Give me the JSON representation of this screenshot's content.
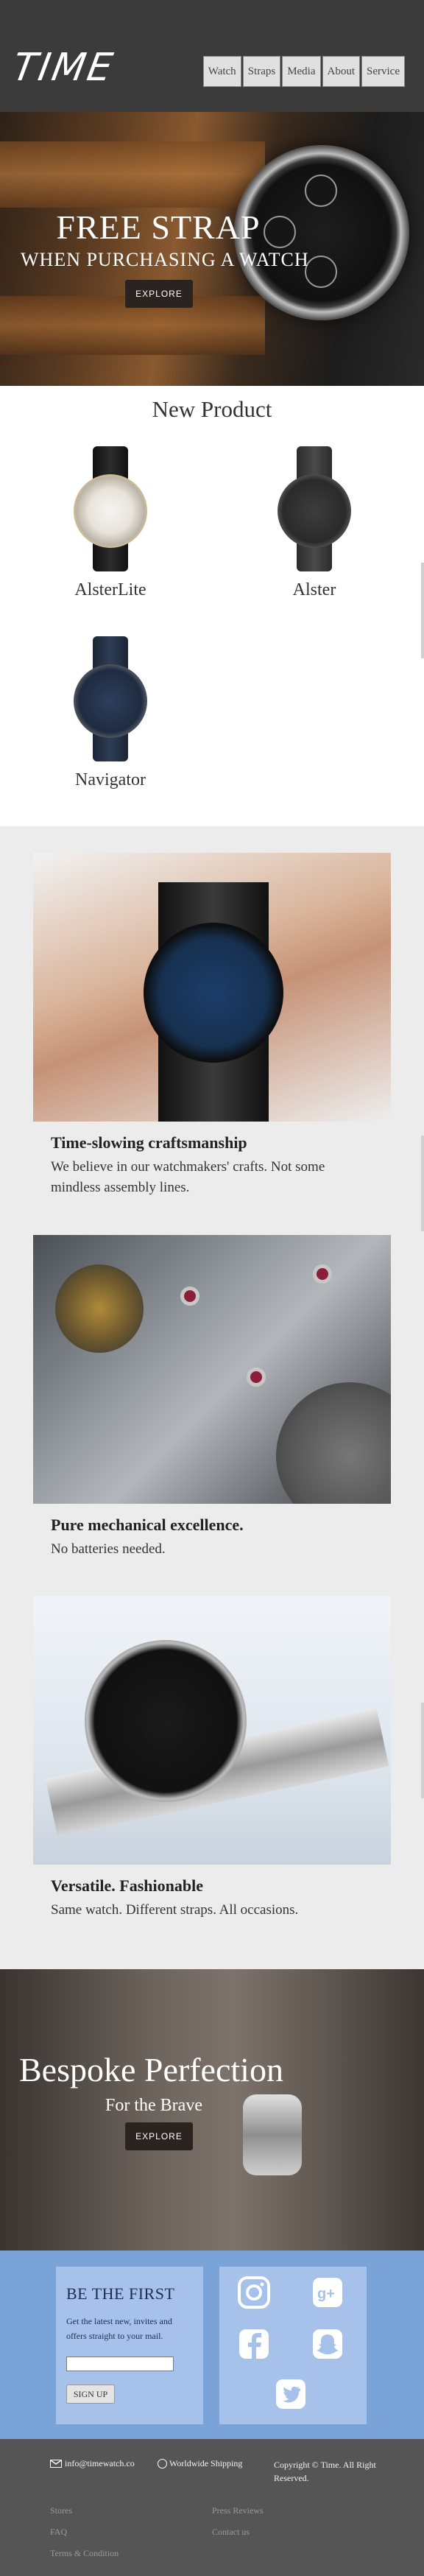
{
  "header": {
    "logo": "TIME",
    "nav": [
      "Watch",
      "Straps",
      "Media",
      "About",
      "Service"
    ]
  },
  "hero": {
    "title": "FREE STRAP",
    "subtitle": "WHEN PURCHASING A WATCH",
    "button": "EXPLORE"
  },
  "new_product": {
    "title": "New Product",
    "items": [
      {
        "name": "AlsterLite"
      },
      {
        "name": "Alster"
      },
      {
        "name": "Navigator"
      }
    ]
  },
  "features": [
    {
      "heading": "Time-slowing craftsmanship",
      "text": "We believe in our watchmakers' crafts. Not some mindless assembly lines."
    },
    {
      "heading": "Pure mechanical excellence.",
      "text": "No batteries needed."
    },
    {
      "heading": "Versatile. Fashionable",
      "text": "Same watch. Different straps. All occasions."
    }
  ],
  "bespoke": {
    "title": "Bespoke Perfection",
    "subtitle": "For the Brave",
    "button": "EXPLORE"
  },
  "signup": {
    "title": "BE THE FIRST",
    "text": "Get the latest new, invites and offers straight to your mail.",
    "email_value": "",
    "button": "SIGN UP"
  },
  "social": [
    "instagram-icon",
    "google-plus-icon",
    "facebook-icon",
    "snapchat-icon",
    "twitter-icon"
  ],
  "footer": {
    "email": "info@timewatch.co",
    "shipping": "Worldwide Shipping",
    "copyright": "Copyright © Time. All Right Reserved.",
    "links": [
      "Stores",
      "FAQ",
      "Terms & Condition",
      "Press Reviews",
      "Contact us"
    ]
  },
  "colors": {
    "header_bg": "#3b3b3b",
    "feature_bg": "#ececec",
    "signup_bg": "#7aa3d8",
    "card_bg": "#a6c1ea",
    "footer_bg": "#555555"
  }
}
